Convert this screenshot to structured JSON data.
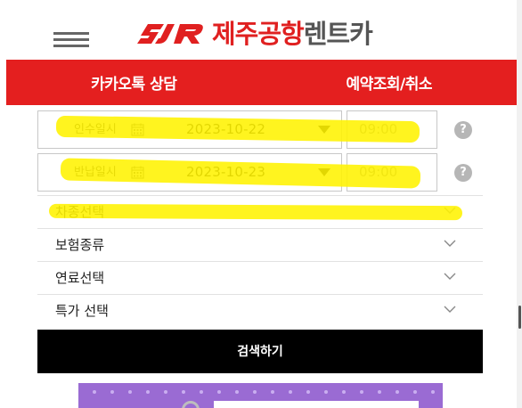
{
  "header": {
    "logo_mark_text": "SJR",
    "logo_red_text": "제주공항",
    "logo_gray_text": "렌트카",
    "brand_color": "#e02020"
  },
  "nav": {
    "color": "#e41f1f",
    "items": [
      {
        "label": "카카오톡 상담"
      },
      {
        "label": "예약조회/취소"
      }
    ]
  },
  "pickup": {
    "label": "인수일시",
    "date": "2023-10-22",
    "time": "09:00",
    "icon": "calendar-icon",
    "help": "?"
  },
  "return": {
    "label": "반납일시",
    "date": "2023-10-23",
    "time": "09:00",
    "icon": "calendar-icon",
    "help": "?"
  },
  "selects": [
    {
      "label": "차종선택"
    },
    {
      "label": "보험종류"
    },
    {
      "label": "연료선택"
    },
    {
      "label": "특가 선택"
    }
  ],
  "search_button": {
    "label": "검색하기"
  },
  "annotation": {
    "highlight_color": "#fff200"
  }
}
